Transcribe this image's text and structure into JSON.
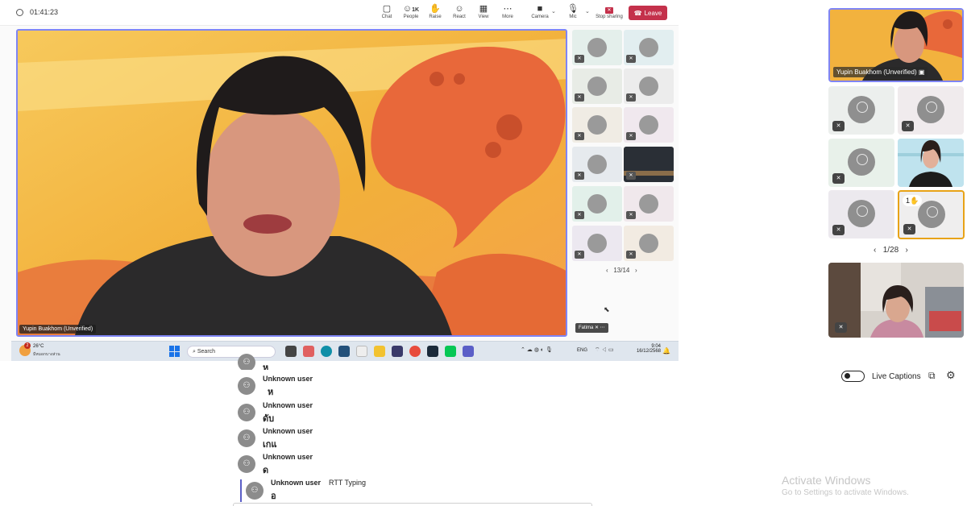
{
  "meeting": {
    "timer": "01:41:23",
    "toolbar": {
      "chat": "Chat",
      "people": "People",
      "people_count": "1K",
      "raise": "Raise",
      "react": "React",
      "view": "View",
      "more": "More",
      "camera": "Camera",
      "mic": "Mic",
      "stop_sharing": "Stop sharing",
      "leave": "Leave"
    },
    "main_speaker_name": "Yupin Buakhom (Unverified)",
    "mini_pager": "13/14",
    "bottom_participant": "Fatima",
    "taskbar": {
      "weather_temp": "26°C",
      "weather_desc": "มีหมอกบางส่วน",
      "search_placeholder": "Search",
      "lang": "ENG",
      "time": "9:04",
      "date": "16/12/2568",
      "notif_count": "2"
    }
  },
  "right_panel": {
    "speaker_name": "Yupin Buakhom (Unverified)",
    "pager": "1/28",
    "raised_hand_count": "1"
  },
  "captions": {
    "toggle_label": "Live Captions",
    "items": [
      {
        "name": "",
        "text": "ห"
      },
      {
        "name": "Unknown user",
        "text": "ห"
      },
      {
        "name": "Unknown user",
        "text": "ดับ"
      },
      {
        "name": "Unknown user",
        "text": "เกแ"
      },
      {
        "name": "Unknown user",
        "text": "ด"
      },
      {
        "name": "Unknown user",
        "status": "RTT Typing",
        "text": "อ"
      }
    ]
  },
  "watermark": {
    "title": "Activate Windows",
    "subtitle": "Go to Settings to activate Windows."
  },
  "colors": {
    "leave_red": "#c4314b",
    "active_border": "#7f85f5",
    "raised_hand_border": "#e8a317"
  }
}
